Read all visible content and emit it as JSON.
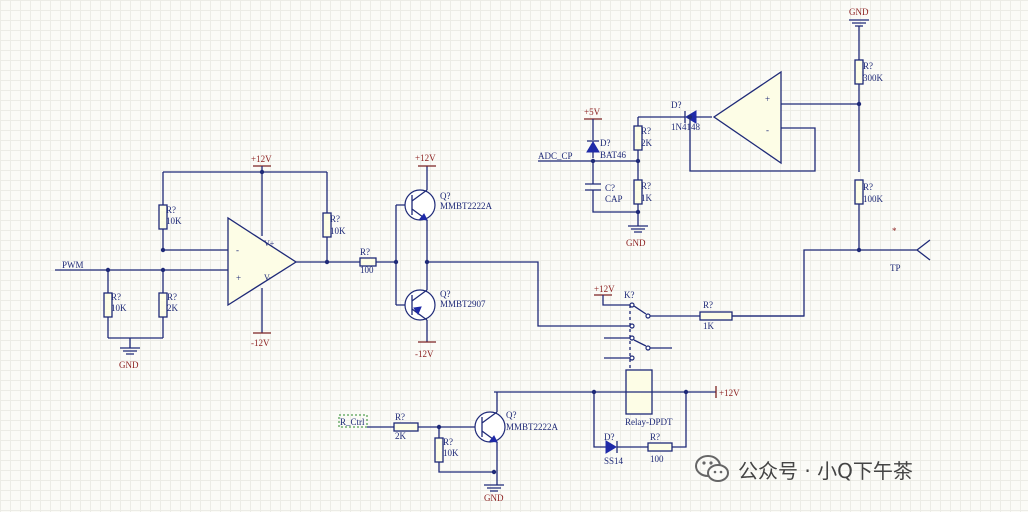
{
  "labels": {
    "gnd": "GND",
    "p12v": "+12V",
    "m12v": "-12V",
    "p5v": "+5V",
    "r": "R?",
    "q": "Q?",
    "d": "D?",
    "c": "C?",
    "k": "K?",
    "plus": "+",
    "minus": "-",
    "vp": "V+",
    "vm": "V-",
    "star": "*"
  },
  "nets": {
    "pwm": "PWM",
    "adc_cp": "ADC_CP",
    "r_ctrl": "R_Ctrl",
    "tp": "TP"
  },
  "values": {
    "r10k": "10K",
    "r2k": "2K",
    "r100": "100",
    "r300k": "300K",
    "r100k": "100K",
    "r1k": "1K",
    "cap": "CAP",
    "q_npn": "MMBT2222A",
    "q_pnp": "MMBT2907",
    "bat46": "BAT46",
    "in4148": "1N4148",
    "ss14": "SS14",
    "relay": "Relay-DPDT"
  },
  "watermark": {
    "text": "公众号 · 小Q下午茶",
    "icon": "wechat-icon"
  },
  "colors": {
    "wire": "#1f2a78",
    "power_label": "#8b1e1e",
    "body_fill": "#fdfde6",
    "background": "#fbfbf7"
  }
}
